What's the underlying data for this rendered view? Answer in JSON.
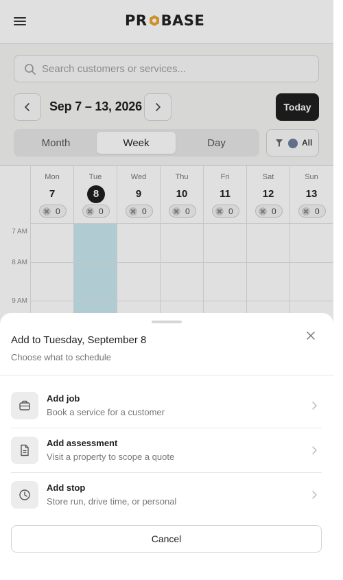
{
  "header": {
    "logo_pre": "PR",
    "logo_post": "BASE"
  },
  "search": {
    "placeholder": "Search customers or services..."
  },
  "date_nav": {
    "range_label": "Sep 7 – 13, 2026",
    "today_label": "Today"
  },
  "view_toggle": {
    "options": [
      "Month",
      "Week",
      "Day"
    ],
    "selected": "Week"
  },
  "filter": {
    "label": "All",
    "color": "#6e7f9e"
  },
  "calendar": {
    "days": [
      {
        "name": "Mon",
        "num": "7",
        "count": "0"
      },
      {
        "name": "Tue",
        "num": "8",
        "count": "0",
        "today": true
      },
      {
        "name": "Wed",
        "num": "9",
        "count": "0"
      },
      {
        "name": "Thu",
        "num": "10",
        "count": "0"
      },
      {
        "name": "Fri",
        "num": "11",
        "count": "0"
      },
      {
        "name": "Sat",
        "num": "12",
        "count": "0"
      },
      {
        "name": "Sun",
        "num": "13",
        "count": "0"
      }
    ],
    "times": [
      "7 AM",
      "8 AM",
      "9 AM"
    ],
    "today_highlight": "#c9e8ee"
  },
  "sheet": {
    "title": "Add to Tuesday, September 8",
    "subtitle": "Choose what to schedule",
    "options": [
      {
        "title": "Add job",
        "desc": "Book a service for a customer",
        "icon": "briefcase-icon"
      },
      {
        "title": "Add assessment",
        "desc": "Visit a property to scope a quote",
        "icon": "document-icon"
      },
      {
        "title": "Add stop",
        "desc": "Store run, drive time, or personal",
        "icon": "clock-icon"
      }
    ],
    "cancel_label": "Cancel"
  },
  "colors": {
    "accent": "#e8a531",
    "dark": "#1f1f1f"
  }
}
